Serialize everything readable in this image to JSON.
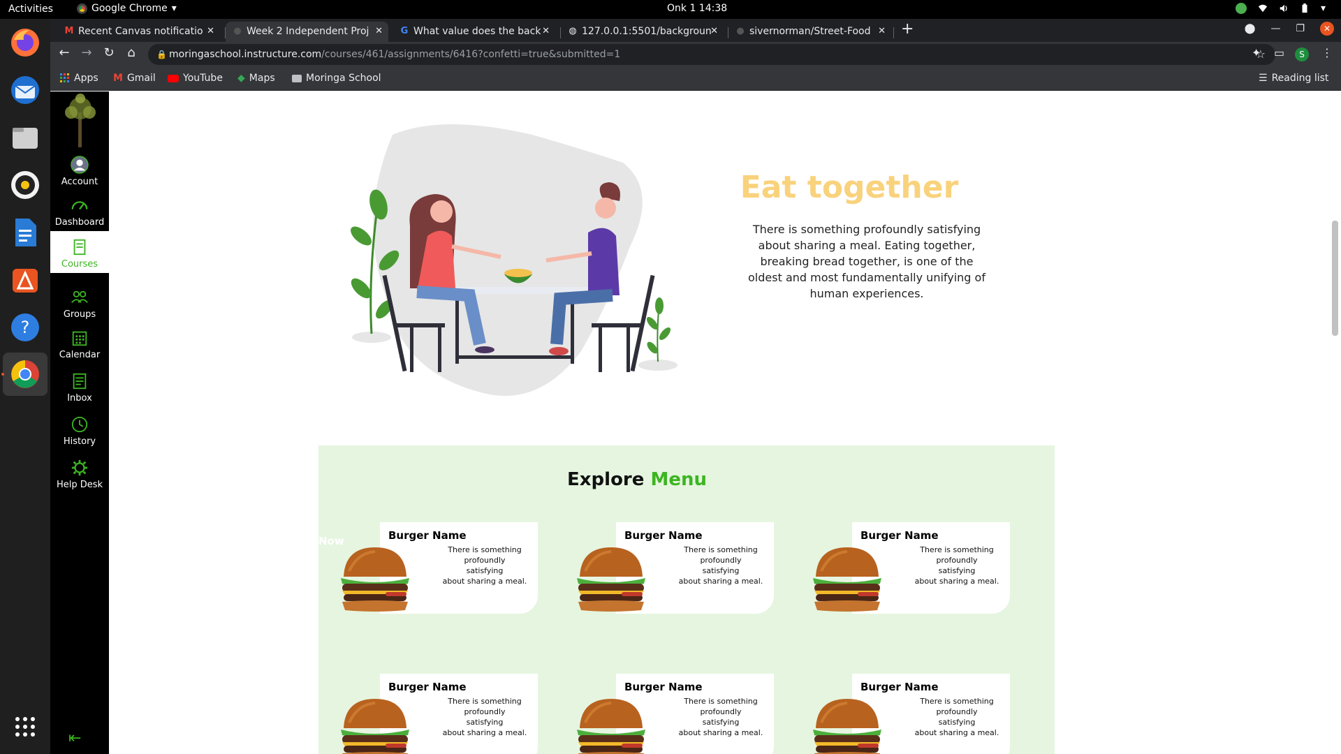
{
  "system": {
    "activities": "Activities",
    "app_menu": "Google Chrome",
    "clock": "Onk 1  14:38"
  },
  "browser": {
    "tabs": [
      {
        "title": "Recent Canvas notificatio",
        "active": false
      },
      {
        "title": "Week 2 Independent Proj",
        "active": true
      },
      {
        "title": "What value does the back",
        "active": false
      },
      {
        "title": "127.0.0.1:5501/backgroun",
        "active": false
      },
      {
        "title": "sivernorman/Street-Food",
        "active": false
      }
    ],
    "url_host": "moringaschool.instructure.com",
    "url_path": "/courses/461/assignments/6416?confetti=true&submitted=1",
    "profile_initial": "S",
    "bookmarks": [
      "Apps",
      "Gmail",
      "YouTube",
      "Maps",
      "Moringa School"
    ],
    "reading_list": "Reading list"
  },
  "canvas_nav": {
    "items": [
      "Account",
      "Dashboard",
      "Courses",
      "Groups",
      "Calendar",
      "Inbox",
      "History",
      "Help Desk"
    ],
    "active": "Courses"
  },
  "hero": {
    "title": "Eat together",
    "text": "There is something profoundly satisfying about sharing a meal. Eating together, breaking bread together, is one of the oldest and most fundamentally unifying of human experiences."
  },
  "menu": {
    "title_main": "Explore",
    "title_accent": "Menu",
    "now_label": "Now",
    "cards": [
      {
        "name": "Burger Name",
        "desc": [
          "There is something",
          "profoundly",
          "satisfying",
          "about sharing a meal."
        ]
      },
      {
        "name": "Burger Name",
        "desc": [
          "There is something",
          "profoundly",
          "satisfying",
          "about sharing a meal."
        ]
      },
      {
        "name": "Burger Name",
        "desc": [
          "There is something",
          "profoundly",
          "satisfying",
          "about sharing a meal."
        ]
      },
      {
        "name": "Burger Name",
        "desc": [
          "There is something",
          "profoundly",
          "satisfying",
          "about sharing a meal."
        ]
      },
      {
        "name": "Burger Name",
        "desc": [
          "There is something",
          "profoundly",
          "satisfying",
          "about sharing a meal."
        ]
      },
      {
        "name": "Burger Name",
        "desc": [
          "There is something",
          "profoundly",
          "satisfying",
          "about sharing a meal."
        ]
      }
    ]
  },
  "colors": {
    "accent_green": "#3cb521",
    "title_yellow": "#f9d27c",
    "menu_bg": "#e6f5e0"
  }
}
